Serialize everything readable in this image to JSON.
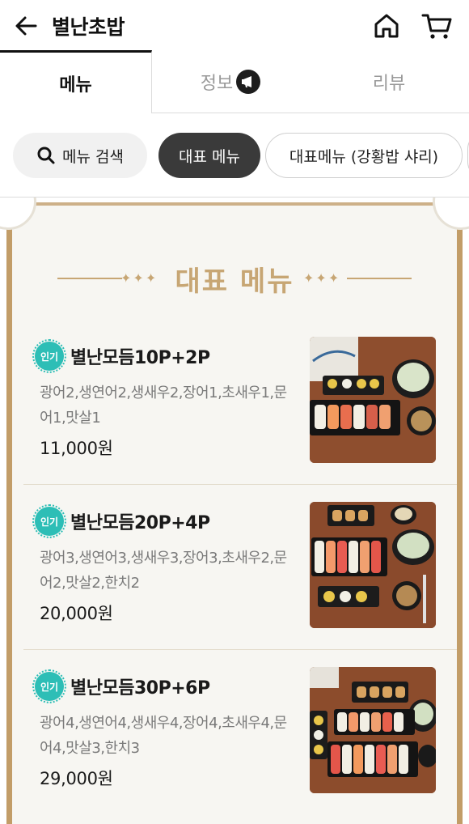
{
  "header": {
    "title": "별난초밥",
    "back_icon": "arrow-left-icon",
    "home_icon": "home-icon",
    "cart_icon": "cart-icon"
  },
  "tabs": [
    {
      "label": "메뉴",
      "active": true
    },
    {
      "label": "정보",
      "active": false,
      "icon": "megaphone-icon"
    },
    {
      "label": "리뷰",
      "active": false
    }
  ],
  "chips": {
    "search_label": "메뉴 검색",
    "items": [
      {
        "label": "대표 메뉴",
        "active": true
      },
      {
        "label": "대표메뉴 (강황밥 샤리)",
        "active": false
      }
    ]
  },
  "section": {
    "title": "대표 메뉴",
    "accent": "#c7a674"
  },
  "menu_items": [
    {
      "badge": "인기",
      "name": "별난모듬10P+2P",
      "desc": "광어2,생연어2,생새우2,장어1,초새우1,문어1,맛살1",
      "price": "11,000원"
    },
    {
      "badge": "인기",
      "name": "별난모듬20P+4P",
      "desc": "광어3,생연어3,생새우3,장어3,초새우2,문어2,맛살2,한치2",
      "price": "20,000원"
    },
    {
      "badge": "인기",
      "name": "별난모듬30P+6P",
      "desc": "광어4,생연어4,생새우4,장어4,초새우4,문어4,맛살3,한치3",
      "price": "29,000원"
    }
  ],
  "colors": {
    "badge": "#2dbeb6",
    "active_chip": "#3a3a3a",
    "board_border": "#c29d68"
  }
}
